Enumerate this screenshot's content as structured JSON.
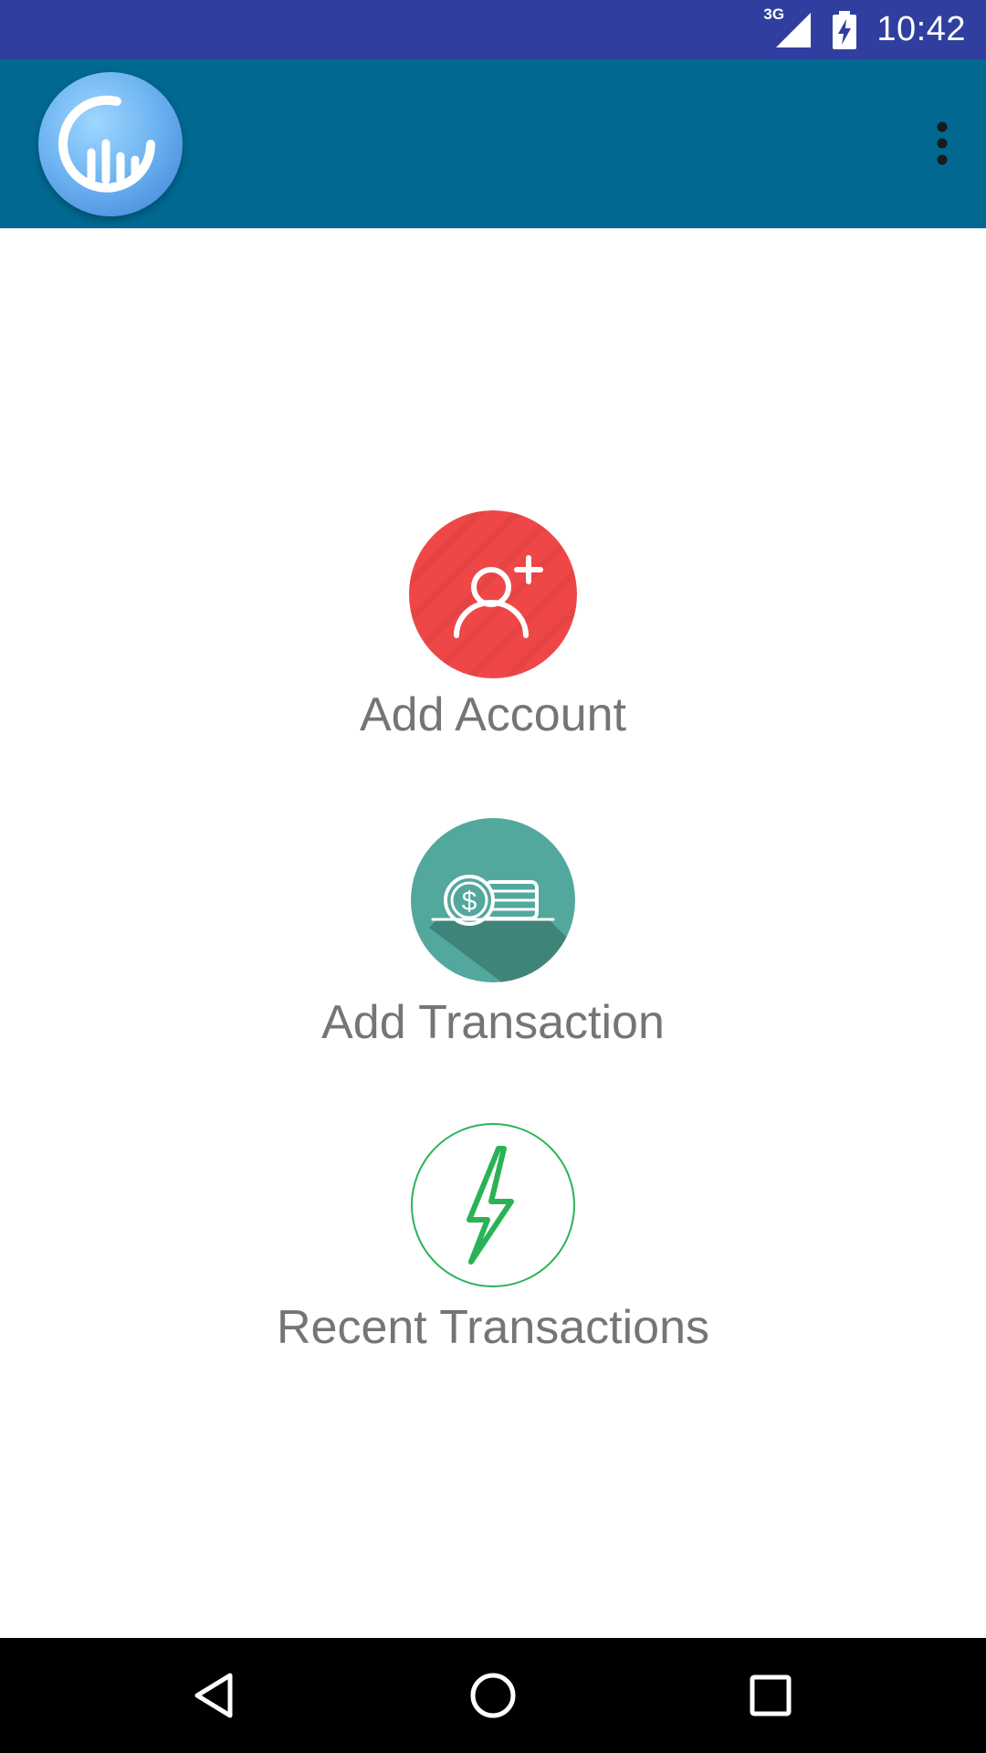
{
  "status_bar": {
    "time": "10:42",
    "network_label": "3G",
    "signal_icon": "cell-signal-icon",
    "battery_icon": "battery-charging-icon",
    "background_color": "#303F9F"
  },
  "app_bar": {
    "logo_icon": "app-logo-chart-icon",
    "overflow_icon": "more-vert-icon",
    "background_color": "#006891"
  },
  "menu": {
    "items": [
      {
        "label": "Add Account",
        "icon": "add-user-icon",
        "color": "#EF4747"
      },
      {
        "label": "Add Transaction",
        "icon": "coins-icon",
        "color": "#52A89C"
      },
      {
        "label": "Recent Transactions",
        "icon": "lightning-bolt-icon",
        "color": "#2AB356"
      }
    ]
  },
  "nav_bar": {
    "back_icon": "back-triangle-icon",
    "home_icon": "home-circle-icon",
    "recents_icon": "recents-square-icon"
  }
}
